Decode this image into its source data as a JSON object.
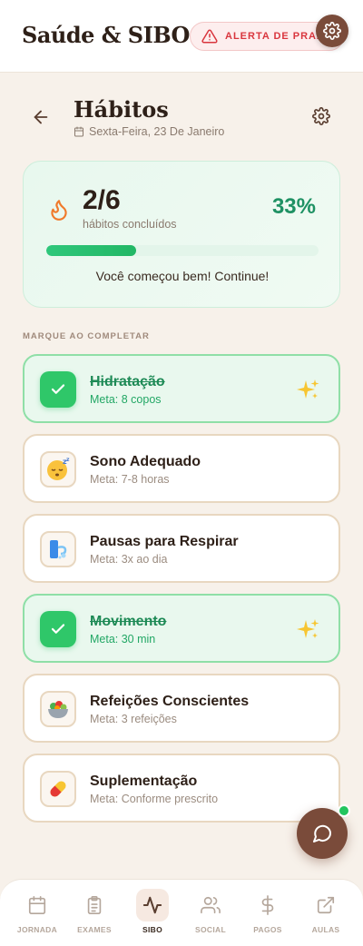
{
  "app": {
    "title": "Saúde & SIBO",
    "alert_label": "ALERTA DE PRAZO"
  },
  "header": {
    "title": "Hábitos",
    "date": "Sexta-Feira, 23 De Janeiro"
  },
  "summary": {
    "completed": "2/6",
    "label": "hábitos concluídos",
    "percent": "33%",
    "progress_fraction": 0.33,
    "message": "Você começou bem! Continue!"
  },
  "section_label": "MARQUE AO COMPLETAR",
  "habits": [
    {
      "title": "Hidratação",
      "sub": "Meta: 8 copos",
      "done": true,
      "icon": "check-icon"
    },
    {
      "title": "Sono Adequado",
      "sub": "Meta: 7-8 horas",
      "done": false,
      "icon": "sleeping-face-icon"
    },
    {
      "title": "Pausas para Respirar",
      "sub": "Meta: 3x ao dia",
      "done": false,
      "icon": "wind-icon"
    },
    {
      "title": "Movimento",
      "sub": "Meta: 30 min",
      "done": true,
      "icon": "check-icon"
    },
    {
      "title": "Refeições Conscientes",
      "sub": "Meta: 3 refeições",
      "done": false,
      "icon": "salad-bowl-icon"
    },
    {
      "title": "Suplementação",
      "sub": "Meta: Conforme prescrito",
      "done": false,
      "icon": "pill-icon"
    }
  ],
  "nav": [
    {
      "label": "JORNADA",
      "icon": "calendar-icon",
      "active": false
    },
    {
      "label": "EXAMES",
      "icon": "clipboard-icon",
      "active": false
    },
    {
      "label": "SIBO",
      "icon": "activity-icon",
      "active": true
    },
    {
      "label": "SOCIAL",
      "icon": "users-icon",
      "active": false
    },
    {
      "label": "PAGOS",
      "icon": "dollar-icon",
      "active": false
    },
    {
      "label": "AULAS",
      "icon": "external-link-icon",
      "active": false
    }
  ],
  "colors": {
    "accent_brown": "#7a4b3a",
    "success_green": "#22b765",
    "alert_red": "#d9363e",
    "background": "#f7f1ea"
  }
}
